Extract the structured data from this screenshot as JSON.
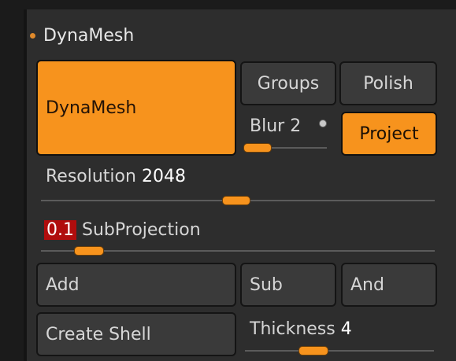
{
  "section": {
    "title": "DynaMesh",
    "accent": "#f7931d"
  },
  "buttons": {
    "dynamesh": "DynaMesh",
    "groups": "Groups",
    "polish": "Polish",
    "project": "Project",
    "add": "Add",
    "sub": "Sub",
    "and": "And",
    "create_shell": "Create Shell"
  },
  "sliders": {
    "blur": {
      "label": "Blur",
      "value": "2",
      "fill": 0.33
    },
    "resolution": {
      "label": "Resolution",
      "value": "2048",
      "fill": 0.49
    },
    "subprojection": {
      "value": "0.1",
      "label": "SubProjection",
      "fill": 0.1
    },
    "thickness": {
      "label": "Thickness",
      "value": "4",
      "fill": 0.34
    }
  },
  "colors": {
    "orange": "#f7931d",
    "value_red": "#b00d0d",
    "panel": "#2d2d2d"
  }
}
